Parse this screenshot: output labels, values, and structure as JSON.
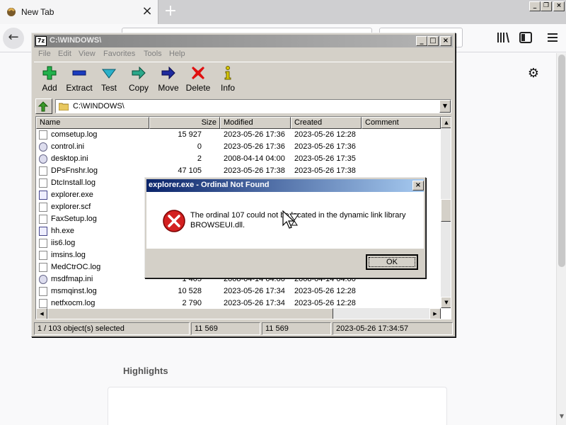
{
  "browser": {
    "tab_title": "New Tab",
    "newtab_symbol": "+",
    "tab_close_symbol": "×",
    "back_symbol": "←",
    "highlights_label": "Highlights"
  },
  "sevenzip": {
    "title": "C:\\WINDOWS\\",
    "title_icon_text": "7z",
    "menu": [
      "File",
      "Edit",
      "View",
      "Favorites",
      "Tools",
      "Help"
    ],
    "toolbar": [
      {
        "label": "Add",
        "icon": "plus-icon",
        "color": "#22b14c"
      },
      {
        "label": "Extract",
        "icon": "minus-icon",
        "color": "#1a3bbf"
      },
      {
        "label": "Test",
        "icon": "check-icon",
        "color": "#2bb0c9"
      },
      {
        "label": "Copy",
        "icon": "copy-arrow-icon",
        "color": "#2aa88a"
      },
      {
        "label": "Move",
        "icon": "move-arrow-icon",
        "color": "#1e2a9e"
      },
      {
        "label": "Delete",
        "icon": "delete-x-icon",
        "color": "#e01010"
      },
      {
        "label": "Info",
        "icon": "info-icon",
        "color": "#d8c800"
      }
    ],
    "address": "C:\\WINDOWS\\",
    "columns": {
      "name": "Name",
      "size": "Size",
      "modified": "Modified",
      "created": "Created",
      "comment": "Comment"
    },
    "files": [
      {
        "name": "comsetup.log",
        "size": "15 927",
        "modified": "2023-05-26 17:36",
        "created": "2023-05-26 12:28",
        "type": "log"
      },
      {
        "name": "control.ini",
        "size": "0",
        "modified": "2023-05-26 17:36",
        "created": "2023-05-26 17:36",
        "type": "cfg"
      },
      {
        "name": "desktop.ini",
        "size": "2",
        "modified": "2008-04-14 04:00",
        "created": "2023-05-26 17:35",
        "type": "cfg"
      },
      {
        "name": "DPsFnshr.log",
        "size": "47 105",
        "modified": "2023-05-26 17:38",
        "created": "2023-05-26 17:38",
        "type": "log"
      },
      {
        "name": "DtcInstall.log",
        "size": "",
        "modified": "",
        "created": "",
        "type": "log"
      },
      {
        "name": "explorer.exe",
        "size": "",
        "modified": "",
        "created": "",
        "type": "exe"
      },
      {
        "name": "explorer.scf",
        "size": "",
        "modified": "",
        "created": "",
        "type": "log"
      },
      {
        "name": "FaxSetup.log",
        "size": "",
        "modified": "",
        "created": "",
        "type": "log"
      },
      {
        "name": "hh.exe",
        "size": "",
        "modified": "",
        "created": "",
        "type": "exe"
      },
      {
        "name": "iis6.log",
        "size": "",
        "modified": "",
        "created": "",
        "type": "log"
      },
      {
        "name": "imsins.log",
        "size": "",
        "modified": "",
        "created": "",
        "type": "log"
      },
      {
        "name": "MedCtrOC.log",
        "size": "",
        "modified": "",
        "created": "",
        "type": "log"
      },
      {
        "name": "msdfmap.ini",
        "size": "1 405",
        "modified": "2008-04-14 04:00",
        "created": "2008-04-14 04:00",
        "type": "cfg"
      },
      {
        "name": "msmqinst.log",
        "size": "10 528",
        "modified": "2023-05-26 17:34",
        "created": "2023-05-26 12:28",
        "type": "log"
      },
      {
        "name": "netfxocm.log",
        "size": "2 790",
        "modified": "2023-05-26 17:34",
        "created": "2023-05-26 12:28",
        "type": "log"
      }
    ],
    "status": {
      "selected": "1 / 103 object(s) selected",
      "size1": "11 569",
      "size2": "11 569",
      "datetime": "2023-05-26 17:34:57"
    }
  },
  "dialog": {
    "title": "explorer.exe - Ordinal Not Found",
    "message_line1": "The ordinal 107 could not be located in the dynamic link library",
    "message_line2": "BROWSEUI.dll.",
    "ok_label": "OK",
    "close_symbol": "×"
  }
}
